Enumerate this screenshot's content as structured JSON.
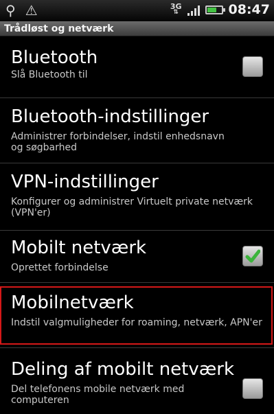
{
  "status_bar": {
    "usb_icon": "usb-icon",
    "warning_icon": "warning-icon",
    "network_type": "3G",
    "battery_level": 0.8,
    "time": "08:47"
  },
  "screen_title": "Trådløst og netværk",
  "items": [
    {
      "title": "Bluetooth",
      "subtitle": "Slå Bluetooth til",
      "checkbox": true,
      "checked": false
    },
    {
      "title": "Bluetooth-indstillinger",
      "subtitle": "Administrer forbindelser, indstil enhedsnavn og søgbarhed"
    },
    {
      "title": "VPN-indstillinger",
      "subtitle": "Konfigurer og administrer Virtuelt private netværk (VPN'er)"
    },
    {
      "title": "Mobilt netværk",
      "subtitle": "Oprettet forbindelse",
      "checkbox": true,
      "checked": true
    },
    {
      "title": "Mobilnetværk",
      "subtitle": "Indstil valgmuligheder for roaming, netværk, APN'er",
      "selected": true
    },
    {
      "title": "Deling af mobilt netværk",
      "subtitle": "Del telefonens mobile netværk med computeren",
      "checkbox": true,
      "checked": false
    }
  ],
  "colors": {
    "selection_outline": "#d51818",
    "check_green": "#3cb43c"
  }
}
